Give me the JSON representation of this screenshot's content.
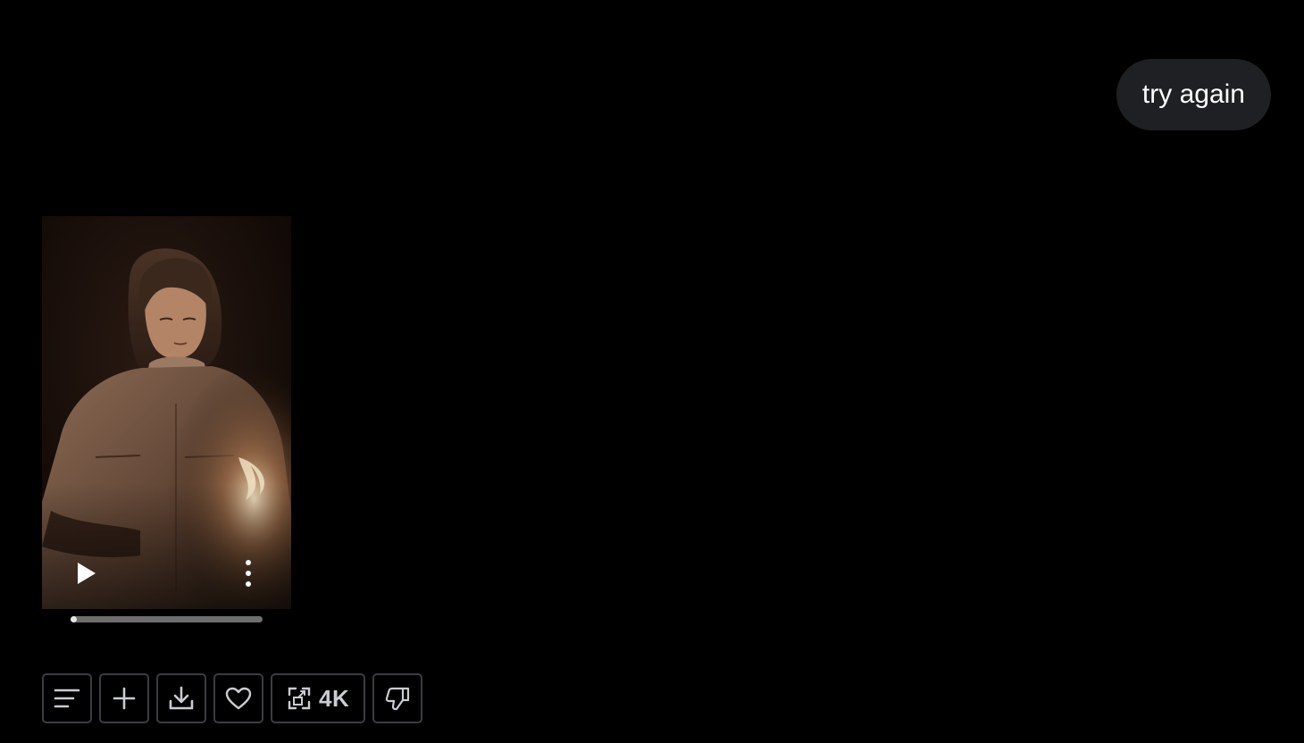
{
  "chat": {
    "user_message": "try again"
  },
  "video": {
    "progress_fraction": 0.0,
    "play_icon": "play-icon",
    "more_icon": "more-vertical-icon"
  },
  "toolbar": {
    "buttons": [
      {
        "name": "details-button",
        "icon": "align-left-icon"
      },
      {
        "name": "add-button",
        "icon": "plus-icon"
      },
      {
        "name": "download-button",
        "icon": "download-icon"
      },
      {
        "name": "favorite-button",
        "icon": "heart-icon"
      },
      {
        "name": "upscale-4k-button",
        "icon": "upscale-icon",
        "label": "4K"
      },
      {
        "name": "dislike-button",
        "icon": "thumbs-down-icon"
      }
    ],
    "upscale_label": "4K"
  },
  "colors": {
    "background": "#000000",
    "bubble": "#1f2023",
    "button_border": "#3a3d42",
    "icon": "#c9ccd1"
  }
}
